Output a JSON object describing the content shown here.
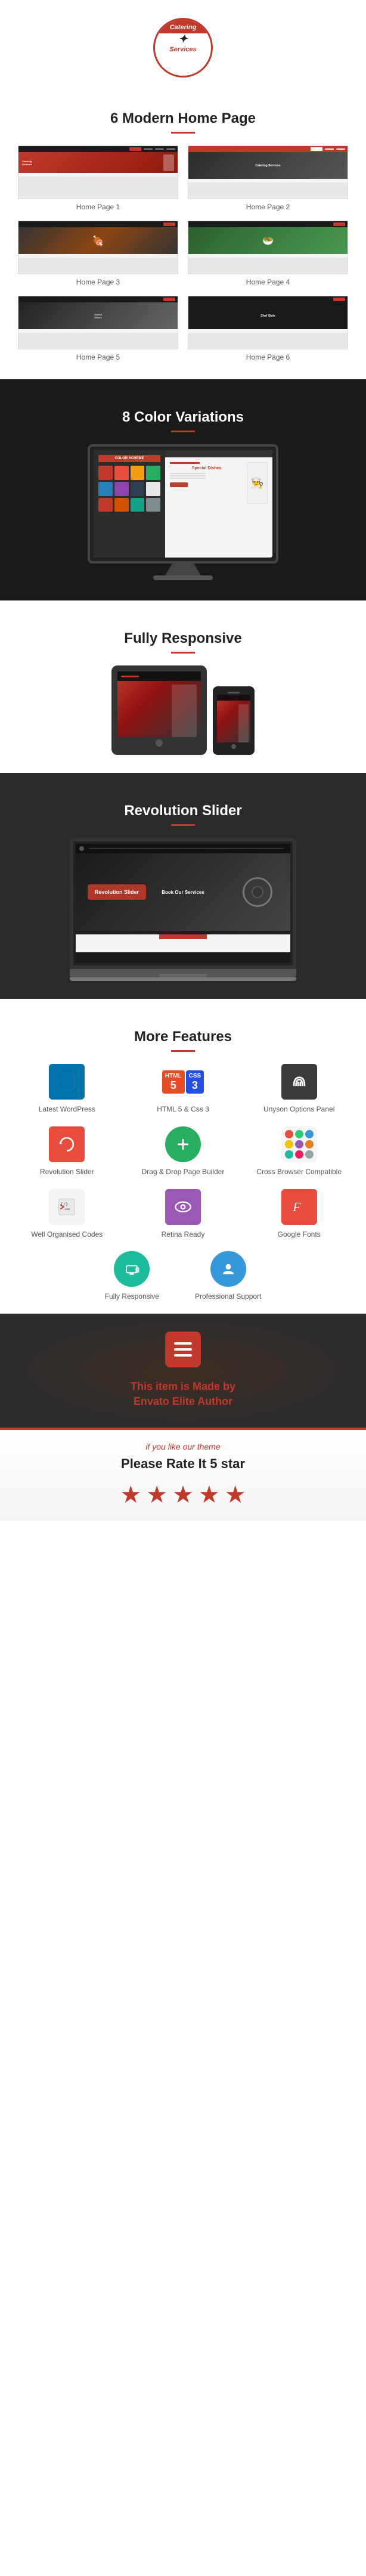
{
  "header": {
    "logo_line1": "Catering",
    "logo_line2": "Services"
  },
  "home_pages_section": {
    "title": "6 Modern Home Page",
    "items": [
      {
        "label": "Home Page 1"
      },
      {
        "label": "Home Page 2"
      },
      {
        "label": "Home Page 3"
      },
      {
        "label": "Home Page 4"
      },
      {
        "label": "Home Page 5"
      },
      {
        "label": "Home Page 6"
      }
    ]
  },
  "color_section": {
    "title": "8 Color Variations",
    "color_scheme_label": "COLOR SCHEME",
    "swatches": [
      "#c0392b",
      "#e74c3c",
      "#f39c12",
      "#27ae60",
      "#2980b9",
      "#8e44ad",
      "#2c3e50",
      "#e8e8e8",
      "#c0392b",
      "#d35400",
      "#16a085",
      "#7f8c8d"
    ],
    "special_text": "Special Dishes",
    "apple_symbol": ""
  },
  "responsive_section": {
    "title": "Fully Responsive"
  },
  "revolution_section": {
    "title": "Revolution Slider",
    "badge_text": "Revolution Slider"
  },
  "features_section": {
    "title": "More Features",
    "features": [
      {
        "id": "wordpress",
        "label": "Latest WordPress",
        "icon_type": "wp"
      },
      {
        "id": "html5css3",
        "label": "HTML 5 & Css 3",
        "icon_type": "html5"
      },
      {
        "id": "unyson",
        "label": "Unyson Options Panel",
        "icon_type": "unyson"
      },
      {
        "id": "revslider",
        "label": "Revolution Slider",
        "icon_type": "revslider"
      },
      {
        "id": "dragdrop",
        "label": "Drag & Drop Page Builder",
        "icon_type": "dragdrop"
      },
      {
        "id": "crossbrowser",
        "label": "Cross Browser Compatible",
        "icon_type": "crossbrowser"
      },
      {
        "id": "code",
        "label": "Well Organised Codes",
        "icon_type": "code"
      },
      {
        "id": "retina",
        "label": "Retina Ready",
        "icon_type": "retina"
      },
      {
        "id": "fonts",
        "label": "Google Fonts",
        "icon_type": "fonts"
      }
    ],
    "features_bottom": [
      {
        "id": "responsive2",
        "label": "Fully Responsive",
        "icon_type": "responsive"
      },
      {
        "id": "support",
        "label": "Professional Support",
        "icon_type": "support"
      }
    ]
  },
  "made_by_section": {
    "line1": "This item is Made by",
    "line2": "Envato Elite Author"
  },
  "rate_section": {
    "subtitle": "if you like our theme",
    "title": "Please Rate It 5 star",
    "stars": [
      "★",
      "★",
      "★",
      "★",
      "★"
    ]
  }
}
